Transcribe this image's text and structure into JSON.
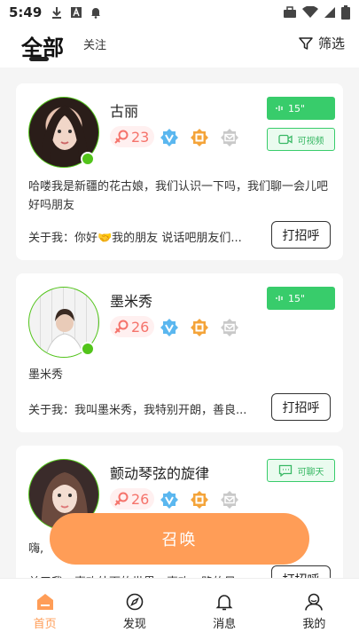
{
  "status_bar": {
    "time": "5:49"
  },
  "header": {
    "tab_all": "全部",
    "tab_follow": "关注",
    "filter_label": "筛选"
  },
  "cards": [
    {
      "name": "古丽",
      "age": "23",
      "call_duration": "15\"",
      "mode_label": "可视频",
      "description": "哈喽我是新疆的花古娘，我们认识一下吗，我们聊一会儿吧好吗朋友",
      "about": "关于我：你好🤝我的朋友 说话吧朋友们...",
      "greet_label": "打招呼"
    },
    {
      "name": "墨米秀",
      "age": "26",
      "call_duration": "15\"",
      "description": "墨米秀",
      "about": "关于我：我叫墨米秀，我特别开朗，善良...",
      "greet_label": "打招呼"
    },
    {
      "name": "颤动琴弦的旋律",
      "age": "26",
      "mode_label": "可聊天",
      "description": "嗨,",
      "about": "关于我：喜欢外面的世界，喜欢一路的风",
      "greet_label": "打招呼"
    }
  ],
  "summon_label": "召唤",
  "bottom_nav": [
    {
      "label": "首页",
      "icon": "home-icon",
      "active": true
    },
    {
      "label": "发现",
      "icon": "compass-icon",
      "active": false
    },
    {
      "label": "消息",
      "icon": "bell-icon",
      "active": false
    },
    {
      "label": "我的",
      "icon": "user-icon",
      "active": false
    }
  ],
  "colors": {
    "accent": "#ff9d57",
    "green": "#38cc6b",
    "online": "#52c41a",
    "age_pink": "#f5736b"
  }
}
